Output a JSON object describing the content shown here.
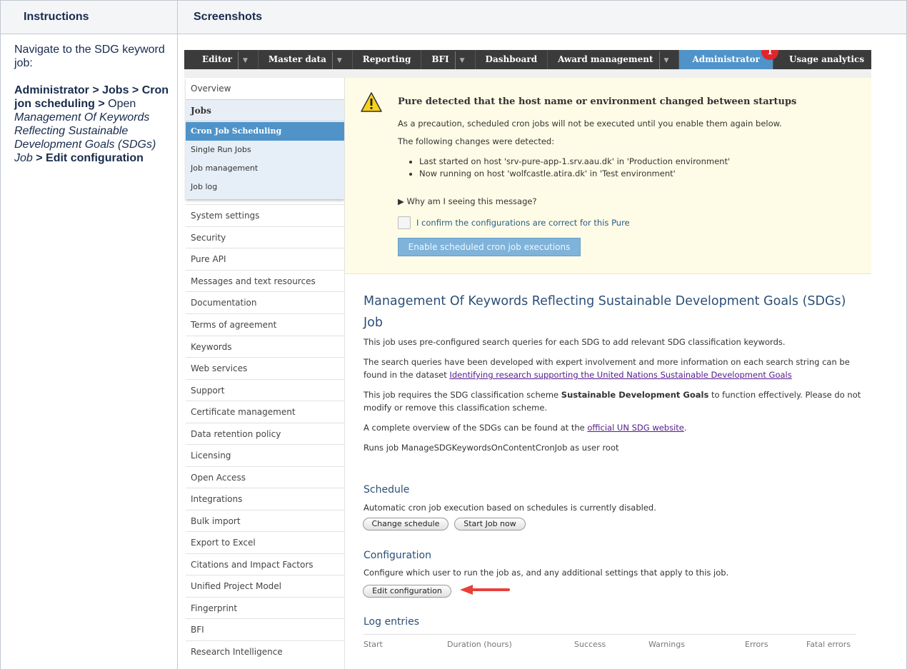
{
  "doc": {
    "col_instructions": "Instructions",
    "col_screenshots": "Screenshots",
    "instr_line1": "Navigate to the SDG keyword job:",
    "instr_path_a": "Administrator > Jobs > Cron jon scheduling > ",
    "instr_open": "Open ",
    "instr_job": "Management Of Keywords Reflecting Sustainable Development Goals (SDGs) Job",
    "instr_sep": " > ",
    "instr_edit": "Edit configuration"
  },
  "topnav": {
    "tabs": [
      "Editor",
      "Master data",
      "Reporting",
      "BFI",
      "Dashboard",
      "Award management",
      "Administrator",
      "Usage analytics"
    ],
    "badge": "1"
  },
  "sidebar": {
    "overview": "Overview",
    "jobs_heading": "Jobs",
    "jobs_items": [
      "Cron Job Scheduling",
      "Single Run Jobs",
      "Job management",
      "Job log"
    ],
    "items": [
      "System settings",
      "Security",
      "Pure API",
      "Messages and text resources",
      "Documentation",
      "Terms of agreement",
      "Keywords",
      "Web services",
      "Support",
      "Certificate management",
      "Data retention policy",
      "Licensing",
      "Open Access",
      "Integrations",
      "Bulk import",
      "Export to Excel",
      "Citations and Impact Factors",
      "Unified Project Model",
      "Fingerprint",
      "BFI",
      "Research Intelligence"
    ]
  },
  "warning": {
    "title": "Pure detected that the host name or environment changed between startups",
    "line1": "As a precaution, scheduled cron jobs will not be executed until you enable them again below.",
    "line2": "The following changes were detected:",
    "change1": "Last started on host 'srv-pure-app-1.srv.aau.dk' in 'Production environment'",
    "change2": "Now running on host 'wolfcastle.atira.dk' in 'Test environment'",
    "why": "▶ Why am I seeing this message?",
    "confirm": "I confirm the configurations are correct for this Pure",
    "enable_btn": "Enable scheduled cron job executions"
  },
  "job": {
    "title": "Management Of Keywords Reflecting Sustainable Development Goals (SDGs) Job",
    "desc1": "This job uses pre-configured search queries for each SDG to add relevant SDG classification keywords.",
    "desc2_a": "The search queries have been developed with expert involvement and more information on each search string can be found in the dataset ",
    "desc2_link": "Identifying research supporting the United Nations Sustainable Development Goals",
    "desc3_a": "This job requires the SDG classification scheme ",
    "desc3_b": "Sustainable Development Goals",
    "desc3_c": " to function effectively. Please do not modify or remove this classification scheme.",
    "desc4_a": "A complete overview of the SDGs can be found at the ",
    "desc4_link": "official UN SDG website",
    "desc4_c": ".",
    "runs_as": "Runs job ManageSDGKeywordsOnContentCronJob as user root",
    "schedule_heading": "Schedule",
    "schedule_text": "Automatic cron job execution based on schedules is currently disabled.",
    "change_schedule": "Change schedule",
    "start_job": "Start Job now",
    "config_heading": "Configuration",
    "config_text": "Configure which user to run the job as, and any additional settings that apply to this job.",
    "edit_config": "Edit configuration",
    "log_heading": "Log entries",
    "log_cols": [
      "Start",
      "Duration (hours)",
      "Success",
      "Warnings",
      "Errors",
      "Fatal errors"
    ]
  },
  "colors": {
    "accent": "#4f93c9",
    "nav_bg": "#3b3b3b",
    "warning_bg": "#fefce6",
    "arrow": "#e8403c"
  }
}
